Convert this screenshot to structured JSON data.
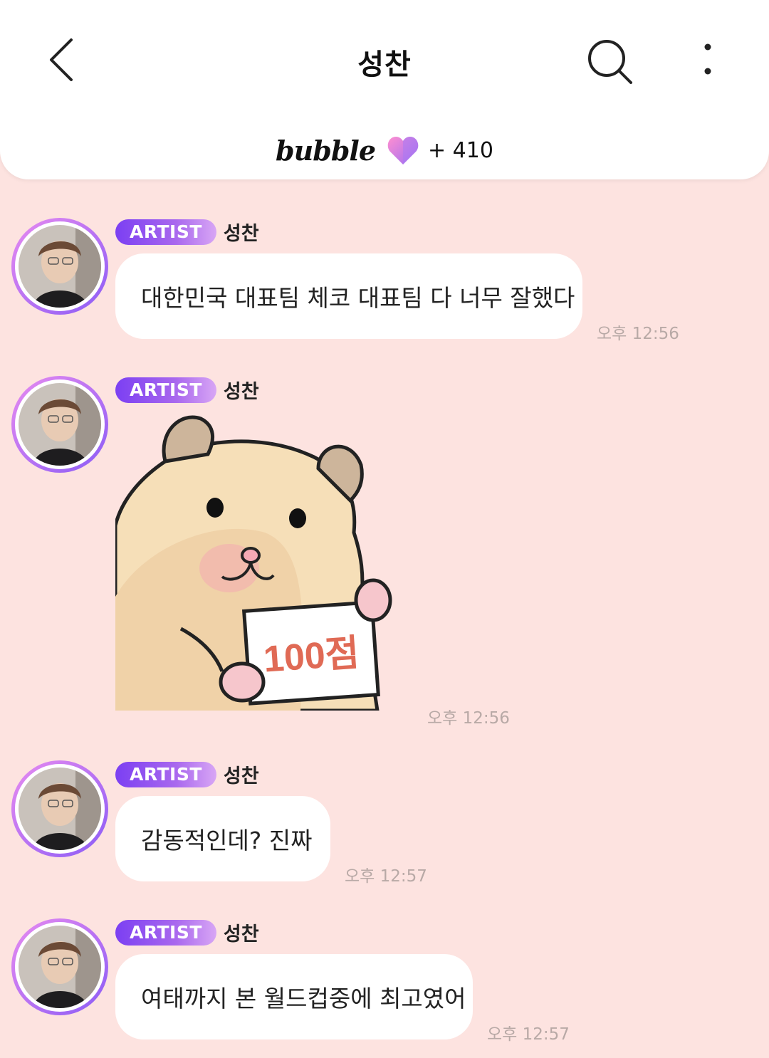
{
  "header": {
    "title": "성찬",
    "brand": "bubble",
    "points": "+ 410"
  },
  "messages": [
    {
      "badge": "ARTIST",
      "sender": "성찬",
      "text": "대한민국 대표팀 체코 대표팀 다 너무 잘했다",
      "time": "오후 12:56"
    },
    {
      "badge": "ARTIST",
      "sender": "성찬",
      "sticker_text": "100점",
      "time": "오후 12:56"
    },
    {
      "badge": "ARTIST",
      "sender": "성찬",
      "text": "감동적인데? 진짜",
      "time": "오후 12:57"
    },
    {
      "badge": "ARTIST",
      "sender": "성찬",
      "text": "여태까지 본 월드컵중에 최고였어",
      "time": "오후 12:57"
    }
  ],
  "colors": {
    "background": "#fde3e0",
    "badge_start": "#7b3ff2",
    "badge_end": "#d8a6f5",
    "time_text": "#b8a9a6"
  }
}
